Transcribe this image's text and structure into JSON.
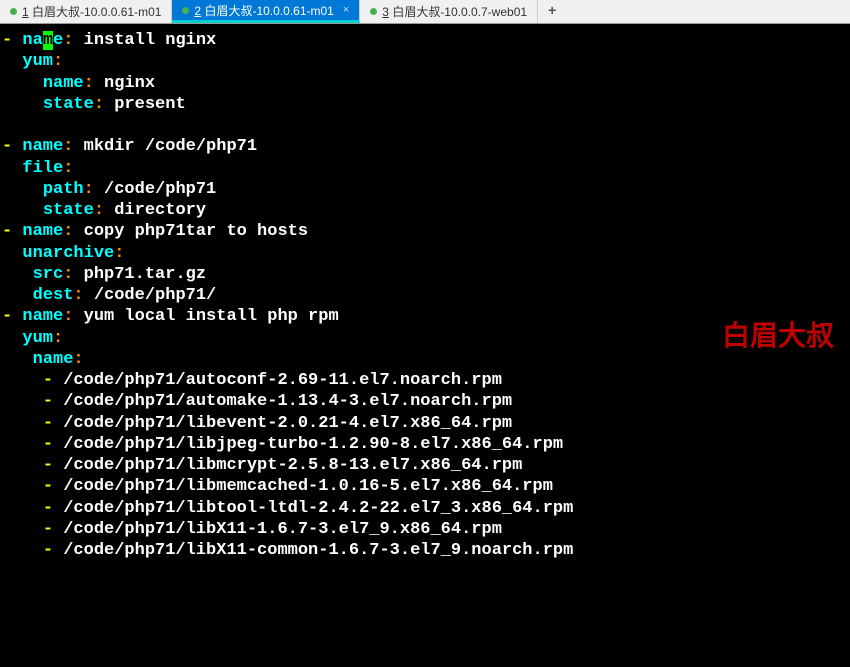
{
  "tabs": [
    {
      "num": "1",
      "label": "白眉大叔-10.0.0.61-m01"
    },
    {
      "num": "2",
      "label": "白眉大叔-10.0.0.61-m01"
    },
    {
      "num": "3",
      "label": "白眉大叔-10.0.0.7-web01"
    }
  ],
  "watermark": "白眉大叔",
  "task1": {
    "name_key": "name",
    "name_val": "install nginx",
    "module": "yum",
    "p1_key": "name",
    "p1_val": "nginx",
    "p2_key": "state",
    "p2_val": "present"
  },
  "task2": {
    "name_key": "name",
    "name_val": "mkdir /code/php71",
    "module": "file",
    "p1_key": "path",
    "p1_val": "/code/php71",
    "p2_key": "state",
    "p2_val": "directory"
  },
  "task3": {
    "name_key": "name",
    "name_val": "copy php71tar to hosts",
    "module": "unarchive",
    "p1_key": "src",
    "p1_val": "php71.tar.gz",
    "p2_key": "dest",
    "p2_val": "/code/php71/"
  },
  "task4": {
    "name_key": "name",
    "name_val": "yum local install php rpm",
    "module": "yum",
    "subkey": "name",
    "items": [
      "/code/php71/autoconf-2.69-11.el7.noarch.rpm",
      "/code/php71/automake-1.13.4-3.el7.noarch.rpm",
      "/code/php71/libevent-2.0.21-4.el7.x86_64.rpm",
      "/code/php71/libjpeg-turbo-1.2.90-8.el7.x86_64.rpm",
      "/code/php71/libmcrypt-2.5.8-13.el7.x86_64.rpm",
      "/code/php71/libmemcached-1.0.16-5.el7.x86_64.rpm",
      "/code/php71/libtool-ltdl-2.4.2-22.el7_3.x86_64.rpm",
      "/code/php71/libX11-1.6.7-3.el7_9.x86_64.rpm",
      "/code/php71/libX11-common-1.6.7-3.el7_9.noarch.rpm"
    ]
  }
}
